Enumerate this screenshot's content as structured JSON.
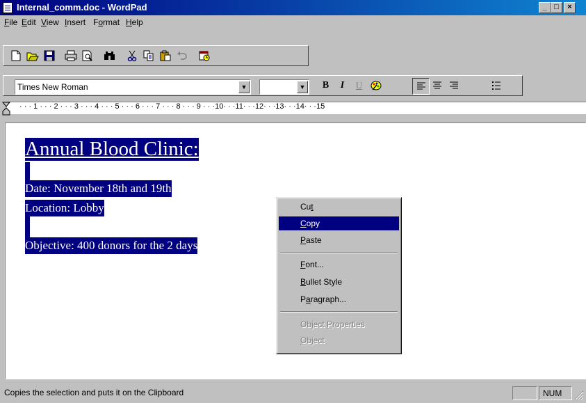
{
  "window": {
    "title": "Internal_comm.doc - WordPad",
    "minimize": "_",
    "maximize": "□",
    "close": "×"
  },
  "menu": [
    {
      "label": "File"
    },
    {
      "label": "Edit"
    },
    {
      "label": "View"
    },
    {
      "label": "Insert"
    },
    {
      "label": "Format"
    },
    {
      "label": "Help"
    }
  ],
  "toolbar": {
    "icons": [
      "new-icon",
      "open-icon",
      "save-icon",
      "print-icon",
      "print-preview-icon",
      "find-icon",
      "cut-icon",
      "copy-icon",
      "paste-icon",
      "undo-icon",
      "insert-datetime-icon"
    ]
  },
  "format_bar": {
    "font_name": "Times New Roman",
    "font_size": "",
    "bold": "B",
    "italic": "I",
    "underline": "U"
  },
  "ruler": {
    "marks": "· · · 1 · · · 2 · · · 3 · · · 4 · · · 5 · · · 6 · · · 7 · · · 8 · · · 9 · · ·10· · ·11· · ·12· · ·13· · ·14· · ·15"
  },
  "document": {
    "heading": "Annual Blood Clinic:",
    "date": "Date: November 18th and 19th",
    "location": "Location: Lobby",
    "objective": "Objective: 400 donors for the 2 days"
  },
  "context_menu": {
    "cut": "Cut",
    "copy": "Copy",
    "paste": "Paste",
    "font": "Font...",
    "bullet_style": "Bullet Style",
    "paragraph": "Paragraph...",
    "object_properties": "Object Properties",
    "object": "Object",
    "highlighted": "copy"
  },
  "status": {
    "text": "Copies the selection and puts it on the Clipboard",
    "num": "NUM"
  },
  "colors": {
    "title_gradient_start": "#000080",
    "title_gradient_end": "#1084d0",
    "selection": "#000080",
    "face": "#c0c0c0"
  }
}
